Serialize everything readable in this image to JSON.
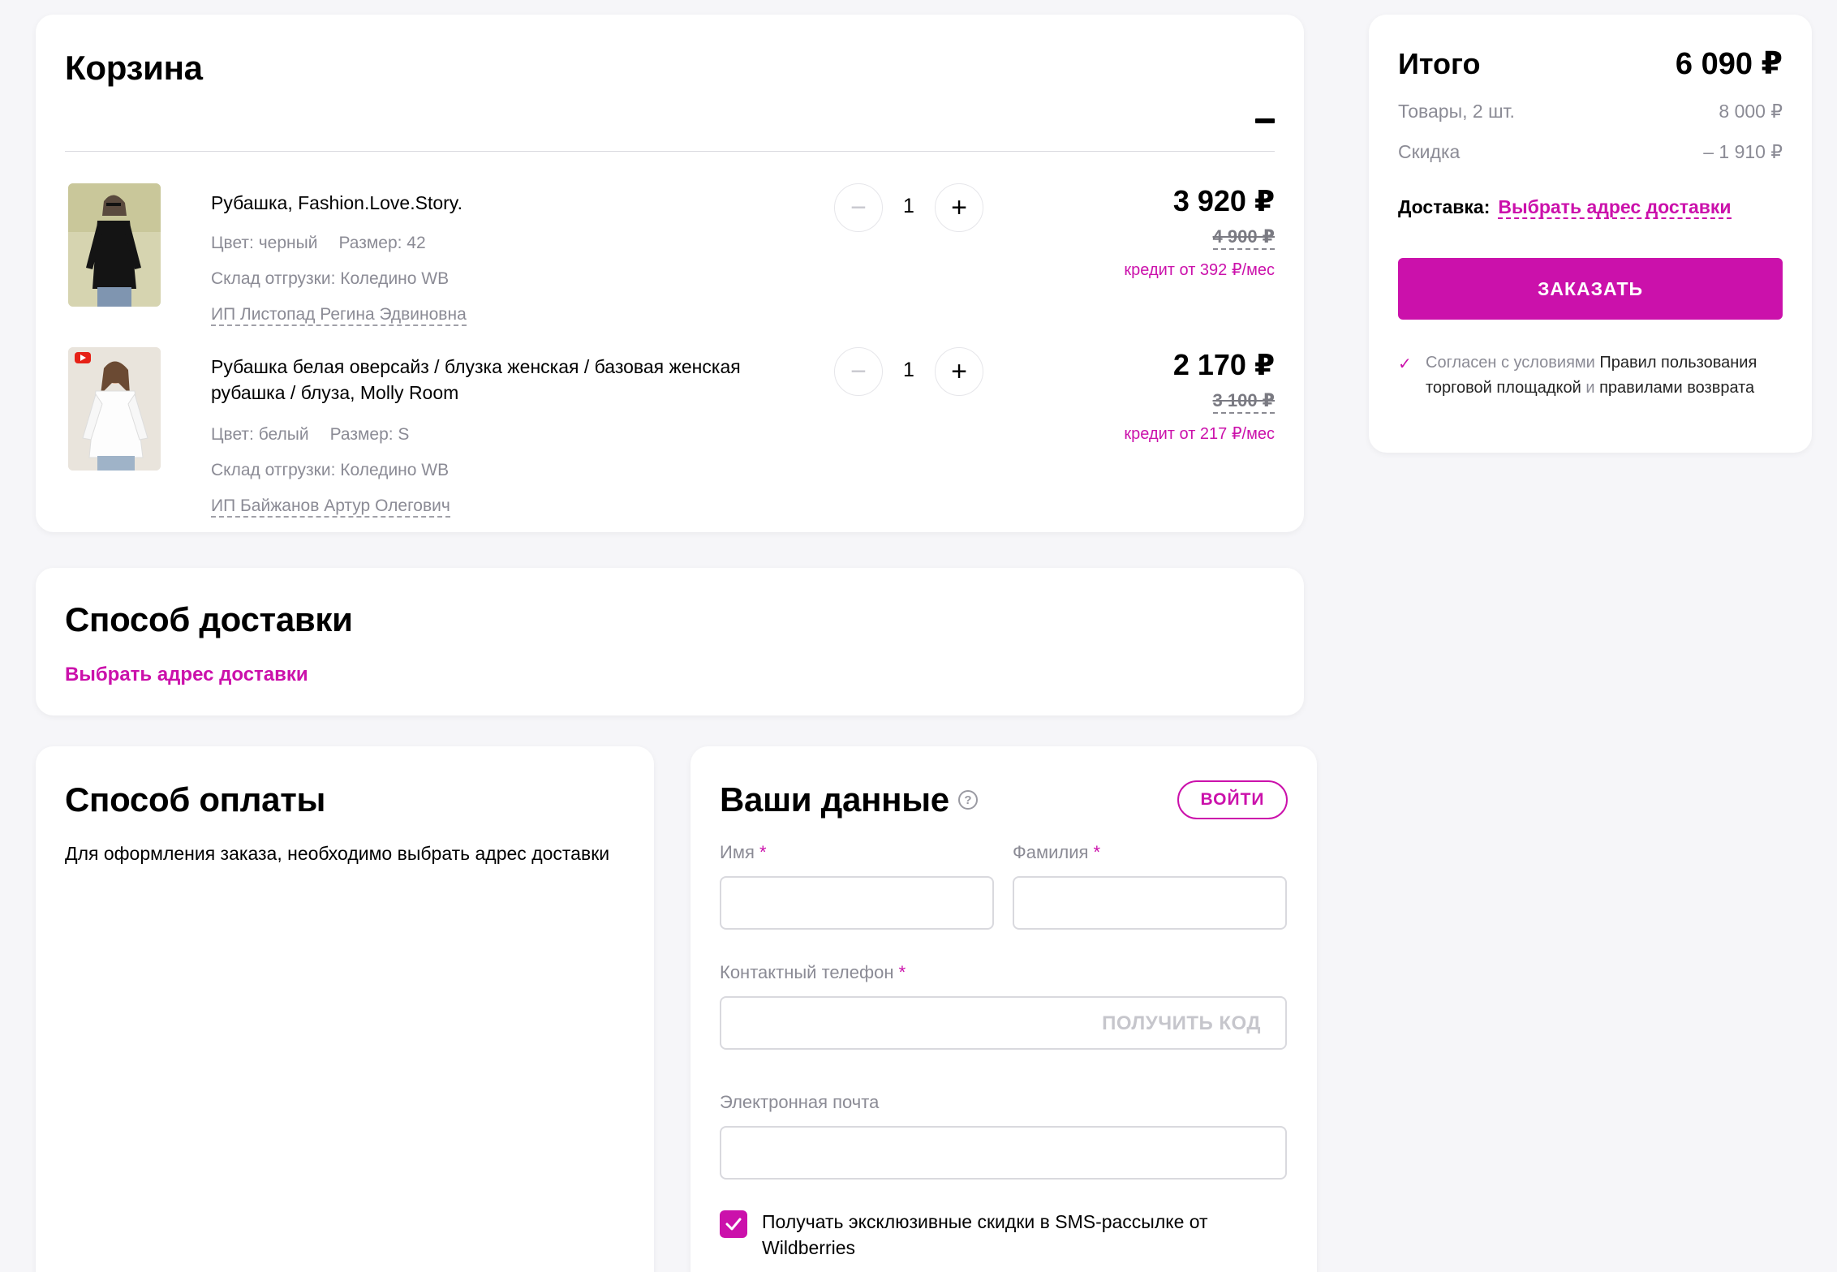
{
  "cart": {
    "title": "Корзина",
    "items": [
      {
        "name": "Рубашка, Fashion.Love.Story.",
        "color": "Цвет: черный",
        "size": "Размер: 42",
        "warehouse": "Склад отгрузки: Коледино WB",
        "seller": "ИП Листопад Регина Эдвиновна",
        "qty": "1",
        "price": "3 920 ₽",
        "old_price": "4 900 ₽",
        "credit": "кредит от 392 ₽/мес"
      },
      {
        "name": "Рубашка белая оверсайз / блузка женская / базовая женская рубашка / блуза, Molly Room",
        "color": "Цвет: белый",
        "size": "Размер: S",
        "warehouse": "Склад отгрузки: Коледино WB",
        "seller": "ИП Байжанов Артур Олегович",
        "qty": "1",
        "price": "2 170 ₽",
        "old_price": "3 100 ₽",
        "credit": "кредит от 217 ₽/мес"
      }
    ],
    "qty_minus": "−",
    "qty_plus": "+"
  },
  "delivery": {
    "title": "Способ доставки",
    "choose_address": "Выбрать адрес доставки"
  },
  "payment": {
    "title": "Способ оплаты",
    "text": "Для оформления заказа, необходимо выбрать адрес доставки"
  },
  "user_data": {
    "title": "Ваши данные",
    "help": "?",
    "login": "ВОЙТИ",
    "first_name_label": "Имя",
    "last_name_label": "Фамилия",
    "phone_label": "Контактный телефон",
    "get_code": "ПОЛУЧИТЬ КОД",
    "email_label": "Электронная почта",
    "required_mark": "*",
    "sms_optin": "Получать эксклюзивные скидки в SMS-рассылке от Wildberries"
  },
  "summary": {
    "title": "Итого",
    "total": "6 090 ₽",
    "goods_label": "Товары, 2 шт.",
    "goods_value": "8 000 ₽",
    "discount_label": "Скидка",
    "discount_value": "– 1 910 ₽",
    "delivery_label": "Доставка:",
    "delivery_link": "Выбрать адрес доставки",
    "order_button": "ЗАКАЗАТЬ",
    "agree_prefix": "Согласен с условиями",
    "agree_rules": "Правил пользования торговой площадкой",
    "agree_and": "и",
    "agree_return": "правилами возврата"
  },
  "colors": {
    "accent": "#cb11ab",
    "background": "#f6f6f9"
  }
}
